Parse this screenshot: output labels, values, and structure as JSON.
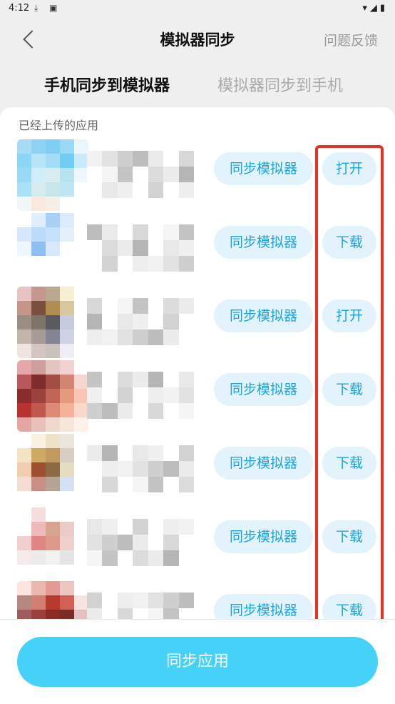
{
  "status_bar": {
    "time": "4:12",
    "left_icons": "⤓ ▣",
    "right_icons": "▾◢▮"
  },
  "header": {
    "title": "模拟器同步",
    "feedback": "问题反馈",
    "back_icon": "chevron-left-icon"
  },
  "tabs": [
    {
      "label": "手机同步到模拟器",
      "active": true
    },
    {
      "label": "模拟器同步到手机",
      "active": false
    }
  ],
  "list": {
    "section_label": "已经上传的应用",
    "items": [
      {
        "sync_label": "同步模拟器",
        "action_label": "打开",
        "icon_colors": [
          "#a8dcf5",
          "#8fd3f4",
          "#7fcff3",
          "#9ad9f5",
          "#eaf6fc",
          "#8ed6f5",
          "#b9e5f8",
          "#a3def6",
          "#6ecdf1",
          "#c7ebf9",
          "#9ad9f5",
          "#cfeefa",
          "#d9ecf1",
          "#b7e3ef",
          "#eef8fc",
          "#a9e0f6",
          "#d7ecec",
          "#c8e6ea",
          "#bfe5f5",
          "#fff",
          "#f1f6f8",
          "#fbe9df",
          "#f6efe8",
          "#fff",
          "#fff"
        ]
      },
      {
        "sync_label": "同步模拟器",
        "action_label": "下载",
        "icon_colors": [
          "#fff",
          "#e1eefb",
          "#a9cff7",
          "#dcebfb",
          "#fff",
          "#d6e8fb",
          "#bcdcf9",
          "#c6e1fb",
          "#e3f0fc",
          "#fff",
          "#eef6fd",
          "#8ebff2",
          "#d8e9fb",
          "#fff",
          "#fff",
          "#fff",
          "#fff",
          "#fff",
          "#fff",
          "#fff",
          "#fff",
          "#fff",
          "#fff",
          "#fff",
          "#fff"
        ]
      },
      {
        "sync_label": "同步模拟器",
        "action_label": "打开",
        "icon_colors": [
          "#e7c4c2",
          "#c4978f",
          "#b9a98f",
          "#f6efd2",
          "#fff",
          "#c59687",
          "#7a4f3d",
          "#b08e50",
          "#d7c7a0",
          "#fff",
          "#9a8e83",
          "#7e7568",
          "#5b5a5e",
          "#c8cbe0",
          "#fff",
          "#c3b7ab",
          "#a59d95",
          "#848594",
          "#cfd1e4",
          "#fff",
          "#efe5e0",
          "#d2c6be",
          "#c9c2bd",
          "#eeeef4",
          "#fff"
        ]
      },
      {
        "sync_label": "同步模拟器",
        "action_label": "下载",
        "icon_colors": [
          "#e4a8a8",
          "#cf9f9c",
          "#e3c5c0",
          "#f1d2d0",
          "#fff",
          "#b9575a",
          "#7e2c2c",
          "#a14e45",
          "#d28573",
          "#f6d6d0",
          "#8a2c2b",
          "#9c413c",
          "#c06456",
          "#e59a80",
          "#f7c6b6",
          "#b7332f",
          "#c05a4e",
          "#dc8c76",
          "#f3b299",
          "#fbd8ca",
          "#e5a6a2",
          "#e9c1b8",
          "#f1d7cd",
          "#f9e6da",
          "#fdf1ea"
        ]
      },
      {
        "sync_label": "同步模拟器",
        "action_label": "下载",
        "icon_colors": [
          "#fff",
          "#f9f1e1",
          "#efe1c6",
          "#ebe6dc",
          "#fff",
          "#f5e4c4",
          "#cfa864",
          "#c19a5f",
          "#d7cfc3",
          "#fff",
          "#f1cdb1",
          "#9e4f30",
          "#8d6a45",
          "#e5dcc1",
          "#fff",
          "#f5ddd3",
          "#c98f87",
          "#b4a294",
          "#d6e0f5",
          "#fff",
          "#fff",
          "#fff",
          "#fff",
          "#fff",
          "#fff"
        ]
      },
      {
        "sync_label": "同步模拟器",
        "action_label": "下载",
        "icon_colors": [
          "#fff",
          "#f7dede",
          "#fff",
          "#fff",
          "#fff",
          "#fff",
          "#eeb9b8",
          "#d5a590",
          "#e9cbc8",
          "#fff",
          "#f1cfcf",
          "#e18484",
          "#dd9a8b",
          "#f1d0cc",
          "#fff",
          "#f6eaea",
          "#ececec",
          "#f2f2f2",
          "#e4e4e4",
          "#fff",
          "#fff",
          "#fff",
          "#fff",
          "#fff",
          "#fff"
        ]
      },
      {
        "sync_label": "同步模拟器",
        "action_label": "下载",
        "icon_colors": [
          "#fbe5de",
          "#eab8b0",
          "#e39a94",
          "#eec5c0",
          "#fff",
          "#b7897e",
          "#d27f73",
          "#b73a2e",
          "#d06255",
          "#f7e3e1",
          "#a05c5c",
          "#9e3f3f",
          "#8c2a25",
          "#7b2b26",
          "#e5c0c0",
          "#fff",
          "#fff",
          "#fff",
          "#fff",
          "#fff",
          "#fff",
          "#fff",
          "#fff",
          "#fff",
          "#fff"
        ]
      }
    ]
  },
  "bottom": {
    "primary_label": "同步应用"
  },
  "colors": {
    "accent": "#1aa4e0",
    "button_bg": "#e3f3fb",
    "primary": "#45d1f8",
    "highlight": "#e63224"
  }
}
